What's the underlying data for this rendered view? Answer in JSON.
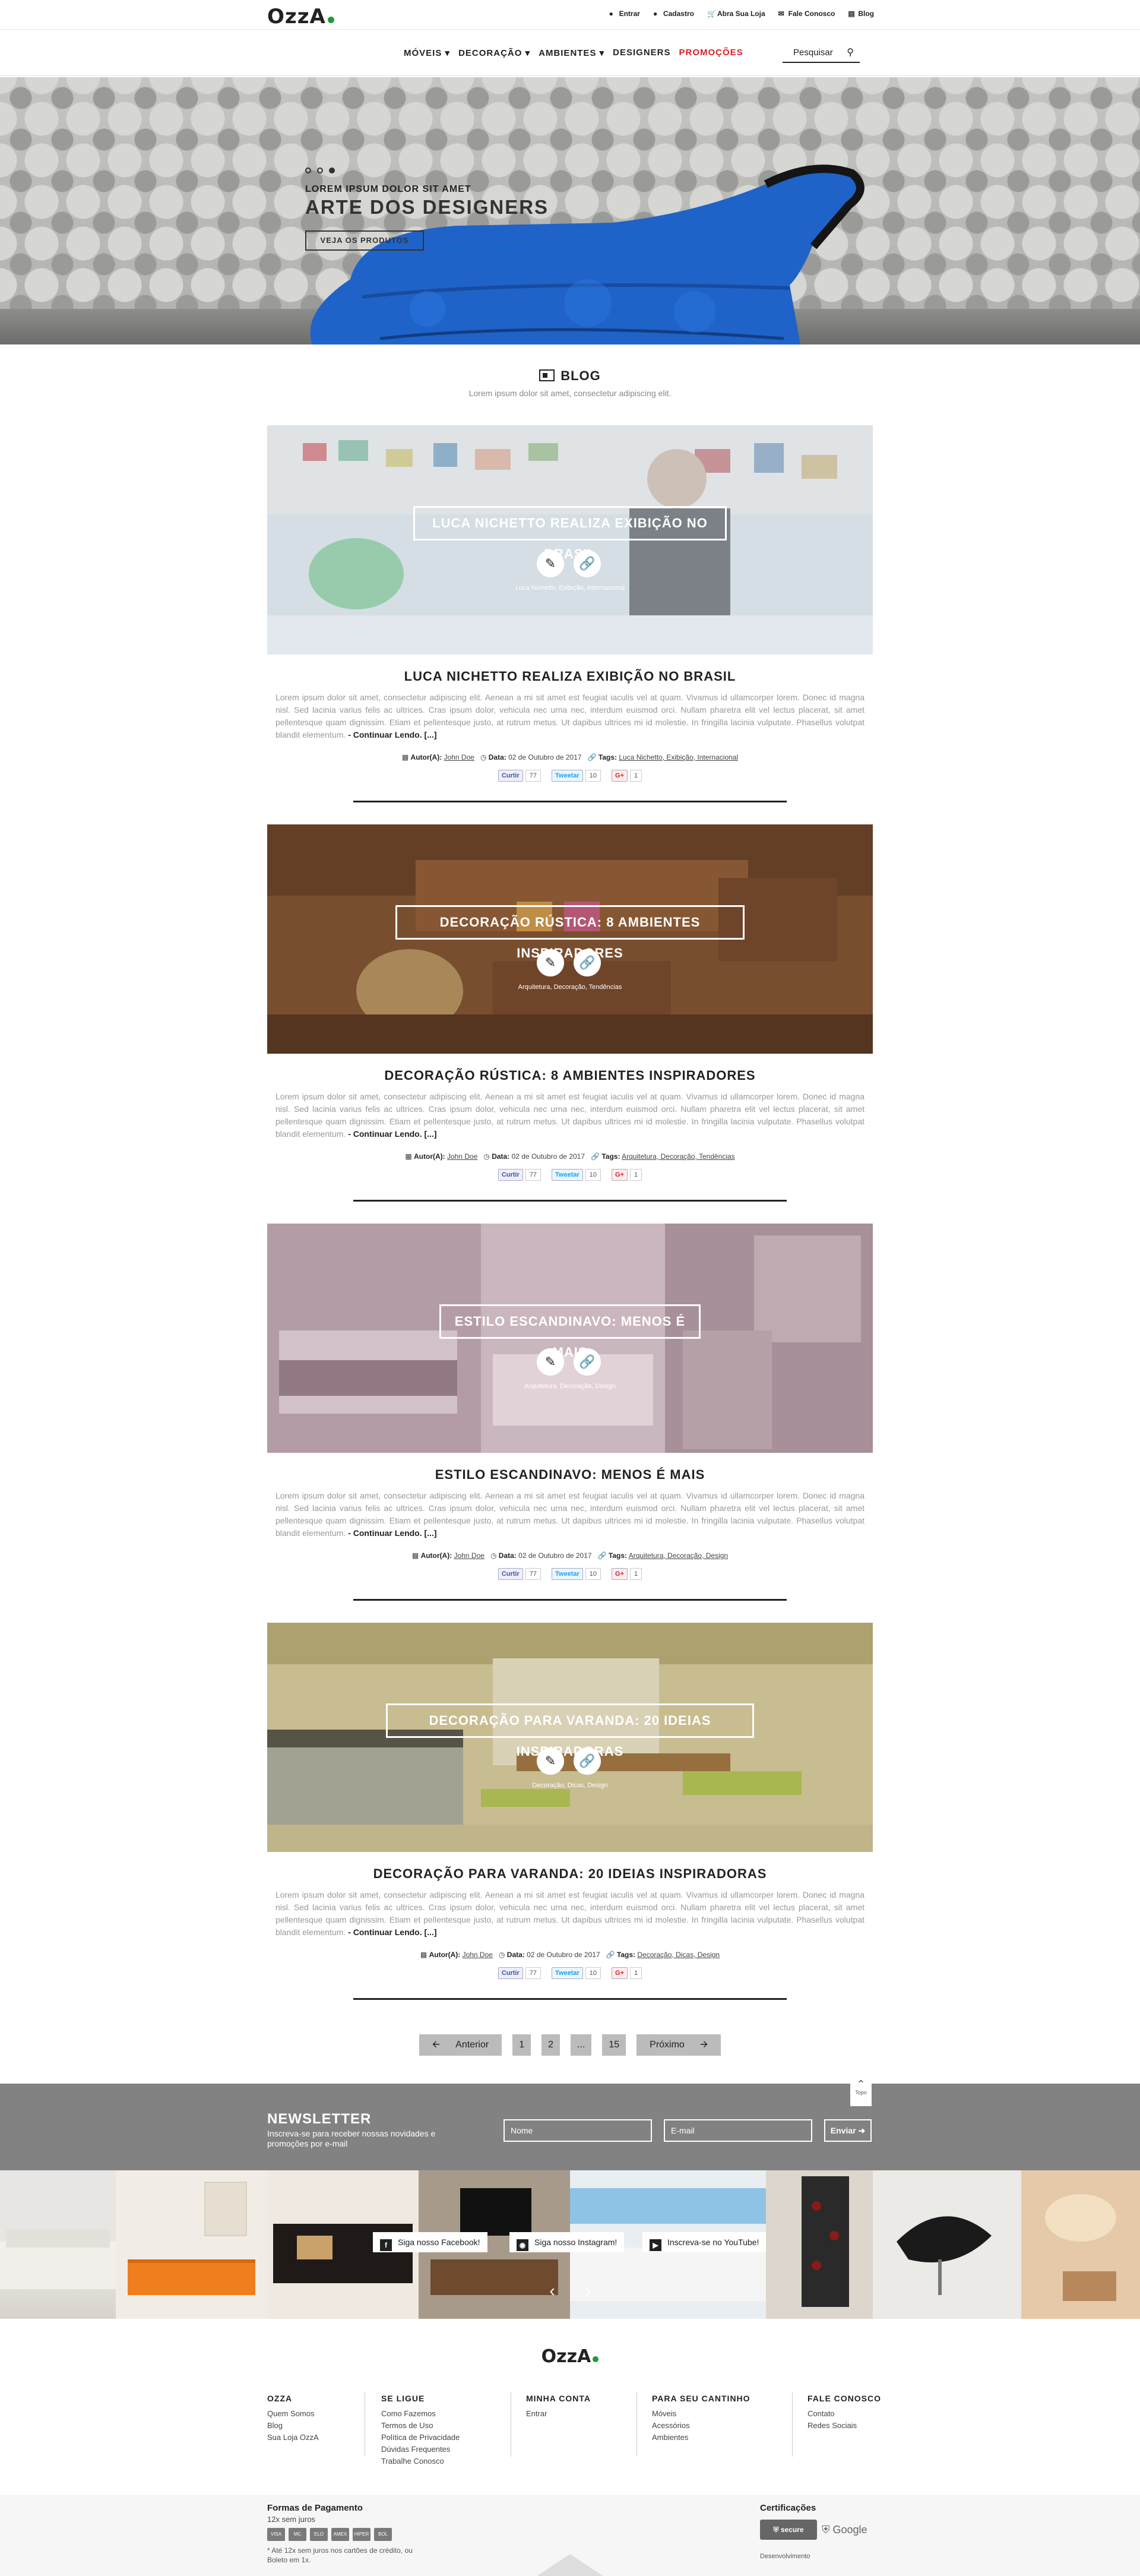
{
  "brand": {
    "logo": "OzzA"
  },
  "top_links": [
    {
      "icon": "user-icon",
      "label": "Entrar"
    },
    {
      "icon": "user-plus-icon",
      "label": "Cadastro"
    },
    {
      "icon": "cart-icon",
      "label": "Abra Sua Loja"
    },
    {
      "icon": "mail-icon",
      "label": "Fale Conosco"
    },
    {
      "icon": "blog-icon",
      "label": "Blog"
    }
  ],
  "nav": {
    "items": [
      "MÓVEIS",
      "DECORAÇÃO",
      "AMBIENTES",
      "DESIGNERS"
    ],
    "promo": "PROMOÇÕES",
    "search_placeholder": "Pesquisar"
  },
  "hero": {
    "kicker": "LOREM IPSUM DOLOR SIT AMET",
    "title": "ARTE DOS DESIGNERS",
    "button": "VEJA OS PRODUTOS",
    "slides_total": 3,
    "active_slide": 3
  },
  "blog": {
    "title": "BLOG",
    "subtitle": "Lorem ipsum dolor sit amet, consectetur adipiscing elit."
  },
  "post_common": {
    "body": "Lorem ipsum dolor sit amet, consectetur adipiscing elit. Aenean a mi sit amet est feugiat iaculis vel at quam. Vivamus id ullamcorper lorem. Donec id magna nisl. Sed lacinia varius felis ac ultrices. Cras ipsum dolor, vehicula nec urna nec, interdum euismod orci. Nullam pharetra elit vel lectus placerat, sit amet pellentesque quam dignissim. Etiam et pellentesque justo, at rutrum metus. Ut dapibus ultrices mi id molestie. In fringilla lacinia vulputate. Phasellus volutpat blandit elementum.",
    "read_more": "- Continuar Lendo. [...]",
    "author_label": "Autor(A):",
    "author": "John Doe",
    "date_label": "Data:",
    "date": "02 de Outubro de 2017",
    "tags_label": "Tags:",
    "share": {
      "fb": "Curtir",
      "fb_count": "77",
      "tw": "Tweetar",
      "tw_count": "10",
      "gp": "G+",
      "gp_count": "1"
    }
  },
  "posts": [
    {
      "title": "LUCA NICHETTO REALIZA EXIBIÇÃO NO BRASIL",
      "tags": "Luca Nichetto, Exibição, Internacional"
    },
    {
      "title": "DECORAÇÃO RÚSTICA: 8 AMBIENTES INSPIRADORES",
      "tags": "Arquitetura, Decoração, Tendências"
    },
    {
      "title": "ESTILO ESCANDINAVO: MENOS É MAIS",
      "tags": "Arquitetura, Decoração, Design"
    },
    {
      "title": "DECORAÇÃO PARA VARANDA: 20 IDEIAS INSPIRADORAS",
      "tags": "Decoração, Dicas, Design"
    }
  ],
  "pagination": {
    "prev": "Anterior",
    "pages": [
      "1",
      "2",
      "...",
      "15"
    ],
    "next": "Próximo"
  },
  "back_to_top": "Topo",
  "newsletter": {
    "title": "NEWSLETTER",
    "subtitle": "Inscreva-se para receber nossas novidades e promoções por e-mail",
    "name_placeholder": "Nome",
    "email_placeholder": "E-mail",
    "send": "Enviar"
  },
  "social": {
    "facebook": "Siga nosso Facebook!",
    "instagram": "Siga nosso Instagram!",
    "youtube": "Inscreva-se no YouTube!"
  },
  "footer": {
    "columns": [
      {
        "title": "OZZA",
        "links": [
          "Quem Somos",
          "Blog",
          "Sua Loja OzzA"
        ]
      },
      {
        "title": "SE LIGUE",
        "links": [
          "Como Fazemos",
          "Termos de Uso",
          "Política de Privacidade",
          "Dúvidas Frequentes",
          "Trabalhe Conosco"
        ]
      },
      {
        "title": "MINHA CONTA",
        "links": [
          "Entrar"
        ]
      },
      {
        "title": "PARA SEU CANTINHO",
        "links": [
          "Móveis",
          "Acessórios",
          "Ambientes"
        ]
      },
      {
        "title": "FALE CONOSCO",
        "links": [
          "Contato",
          "Redes Sociais"
        ]
      }
    ],
    "payment_title": "Formas de Pagamento",
    "payment_sub": "12x sem juros",
    "payment_note": "* Até 12x sem juros nos cartões de crédito, ou Boleto em 1x.",
    "cards": [
      "VISA",
      "MC",
      "ELO",
      "AMEX",
      "HIPER",
      "BOL"
    ],
    "cert_title": "Certificações",
    "ssl": "secure",
    "google": "Google",
    "dev": "Desenvolvimento"
  },
  "colors": {
    "promo": "#d8202a",
    "brand_dot": "#1e9a3c",
    "newsletter_bg": "#828282"
  }
}
